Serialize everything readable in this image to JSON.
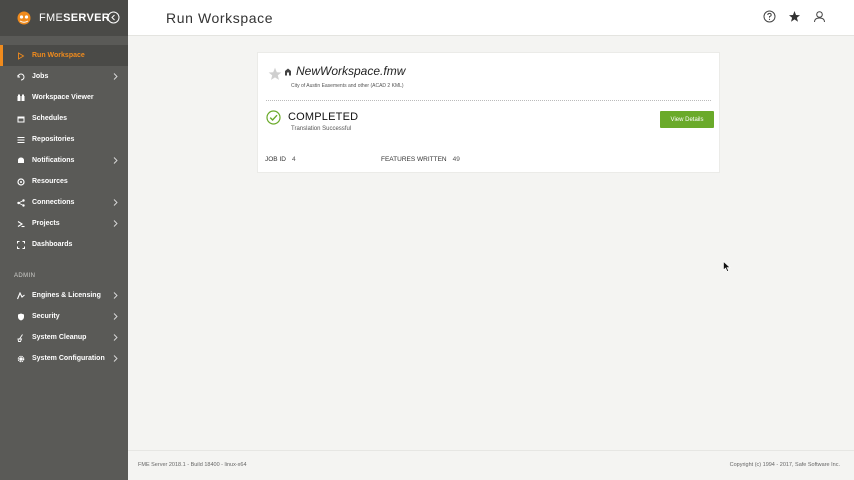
{
  "brand": {
    "part1": "FME",
    "part2": "SERVER"
  },
  "sidebar": {
    "items": [
      {
        "label": "Run Workspace",
        "icon": "play-icon",
        "active": true,
        "chevron": false
      },
      {
        "label": "Jobs",
        "icon": "jobs-icon",
        "chevron": true
      },
      {
        "label": "Workspace Viewer",
        "icon": "viewer-icon",
        "chevron": false
      },
      {
        "label": "Schedules",
        "icon": "calendar-icon",
        "chevron": false
      },
      {
        "label": "Repositories",
        "icon": "repository-icon",
        "chevron": false
      },
      {
        "label": "Notifications",
        "icon": "notification-icon",
        "chevron": true
      },
      {
        "label": "Resources",
        "icon": "resources-icon",
        "chevron": false
      },
      {
        "label": "Connections",
        "icon": "share-icon",
        "chevron": true
      },
      {
        "label": "Projects",
        "icon": "projects-icon",
        "chevron": true
      },
      {
        "label": "Dashboards",
        "icon": "dashboard-icon",
        "chevron": false
      }
    ],
    "admin_label": "ADMIN",
    "admin_items": [
      {
        "label": "Engines & Licensing",
        "icon": "engine-icon",
        "chevron": true
      },
      {
        "label": "Security",
        "icon": "shield-icon",
        "chevron": true
      },
      {
        "label": "System Cleanup",
        "icon": "cleanup-icon",
        "chevron": true
      },
      {
        "label": "System Configuration",
        "icon": "gear-icon",
        "chevron": true
      }
    ]
  },
  "header": {
    "title": "Run Workspace"
  },
  "card": {
    "workspace_name": "NewWorkspace.fmw",
    "description": "City of Austin Easements and other (ACAD 2 KML)",
    "status": "COMPLETED",
    "status_sub": "Translation Successful",
    "button_label": "View Details",
    "job_id_label": "JOB ID",
    "job_id_value": "4",
    "features_label": "FEATURES WRITTEN",
    "features_value": "49"
  },
  "footer": {
    "left": "FME Server 2018.1 - Build 18400 - linux-x64",
    "right": "Copyright (c) 1994 - 2017, Safe Software Inc."
  },
  "colors": {
    "accent": "#f08b1d",
    "success": "#6aaa2a",
    "sidebar": "#5a5a57"
  }
}
